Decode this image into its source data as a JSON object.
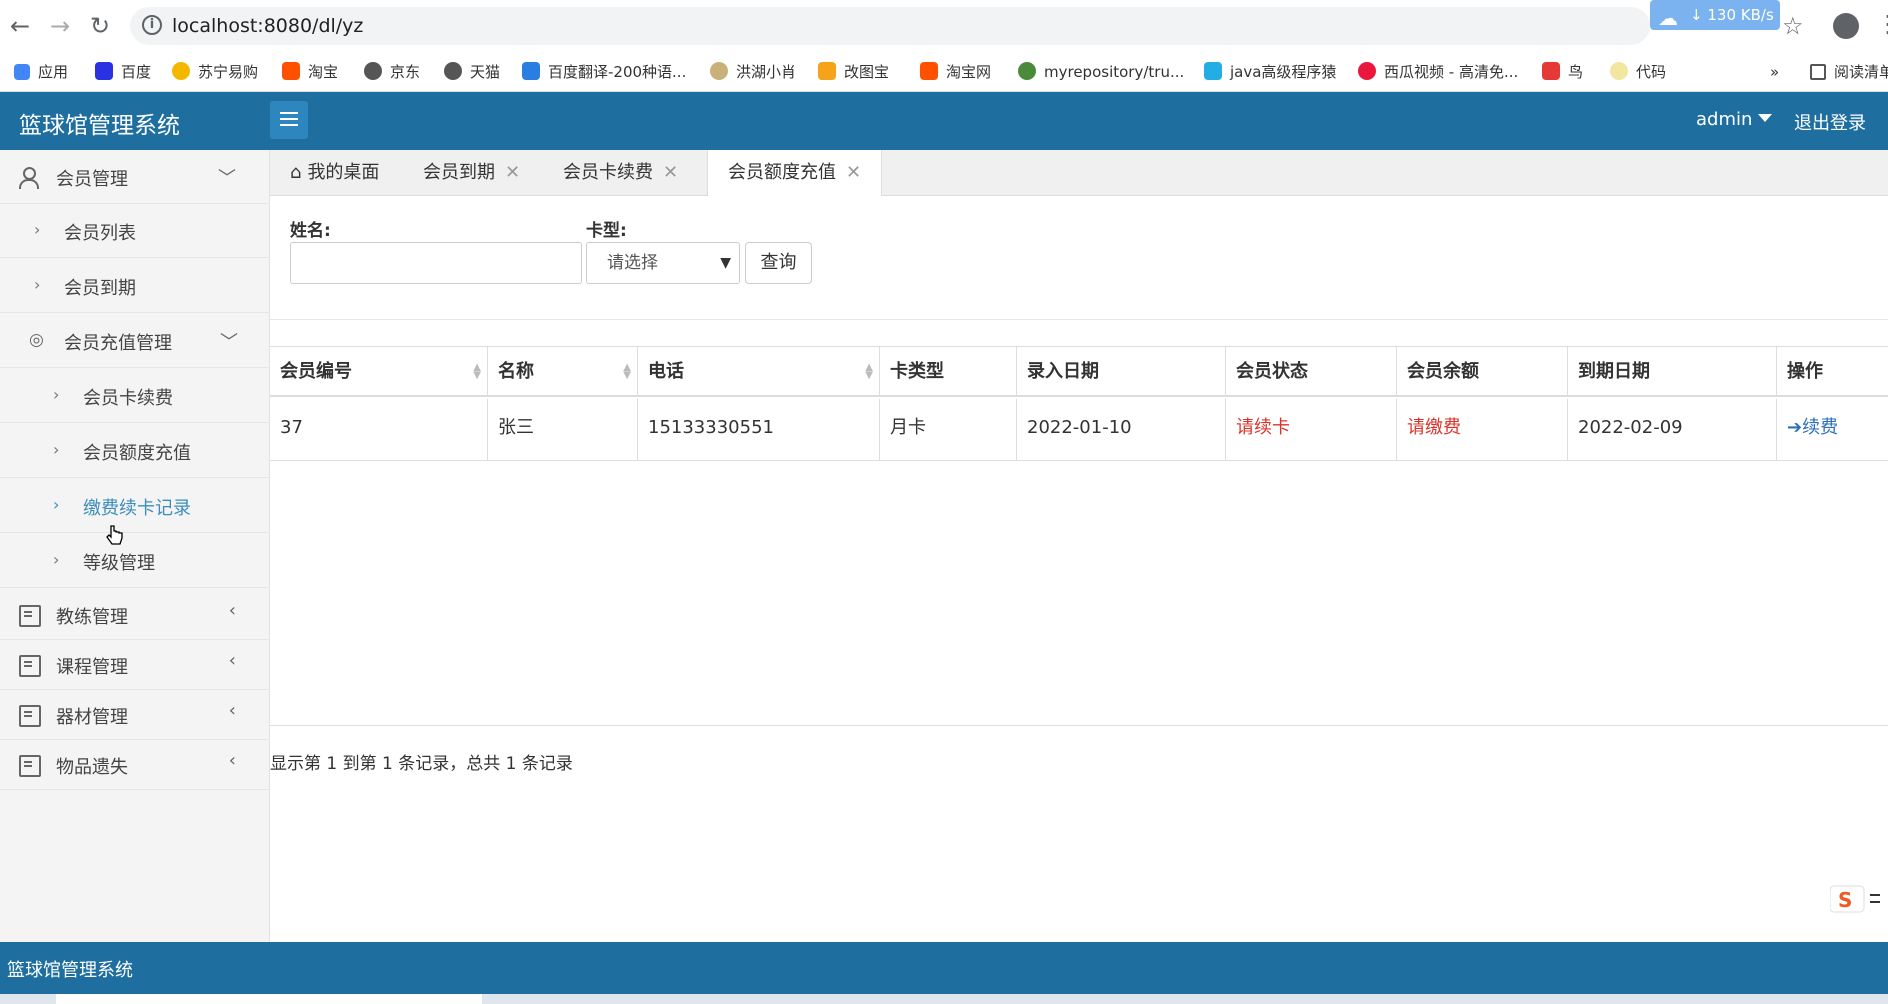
{
  "browser": {
    "url": "localhost:8080/dl/yz",
    "download_speed": "130 KB/s",
    "bookmarks": [
      "应用",
      "百度",
      "苏宁易购",
      "淘宝",
      "京东",
      "天猫",
      "百度翻译-200种语...",
      "洪湖小肖",
      "改图宝",
      "淘宝网",
      "myrepository/tru...",
      "java高级程序猿",
      "西瓜视频 - 高清免...",
      "鸟",
      "代码",
      "阅读清单"
    ],
    "bookmarks_more": "»"
  },
  "header": {
    "title": "篮球馆管理系统",
    "user": "admin",
    "logout": "退出登录"
  },
  "sidebar": {
    "member_mgmt": "会员管理",
    "member_list": "会员列表",
    "member_expire": "会员到期",
    "recharge_mgmt": "会员充值管理",
    "card_renew": "会员卡续费",
    "quota_recharge": "会员额度充值",
    "renew_records": "缴费续卡记录",
    "level_mgmt": "等级管理",
    "coach_mgmt": "教练管理",
    "course_mgmt": "课程管理",
    "equipment_mgmt": "器材管理",
    "lost_items": "物品遗失"
  },
  "tabs": {
    "home": "我的桌面",
    "t1": "会员到期",
    "t2": "会员卡续费",
    "t3": "会员额度充值"
  },
  "search": {
    "name_label": "姓名:",
    "name_value": "",
    "card_label": "卡型:",
    "card_selected": "请选择",
    "query_btn": "查询"
  },
  "table": {
    "columns": [
      "会员编号",
      "名称",
      "电话",
      "卡类型",
      "录入日期",
      "会员状态",
      "会员余额",
      "到期日期",
      "操作"
    ],
    "row": {
      "id": "37",
      "name": "张三",
      "phone": "15133330551",
      "card_type": "月卡",
      "entry_date": "2022-01-10",
      "status": "请续卡",
      "balance": "请缴费",
      "expire_date": "2022-02-09",
      "action": "续费"
    }
  },
  "pagination_info": "显示第 1 到第 1 条记录，总共 1 条记录",
  "footer": "篮球馆管理系统",
  "colors": {
    "header_bg": "#1e6fa0",
    "active_link": "#3c8dbc",
    "status_red": "#d9342b",
    "action_blue": "#2c6fbb"
  }
}
